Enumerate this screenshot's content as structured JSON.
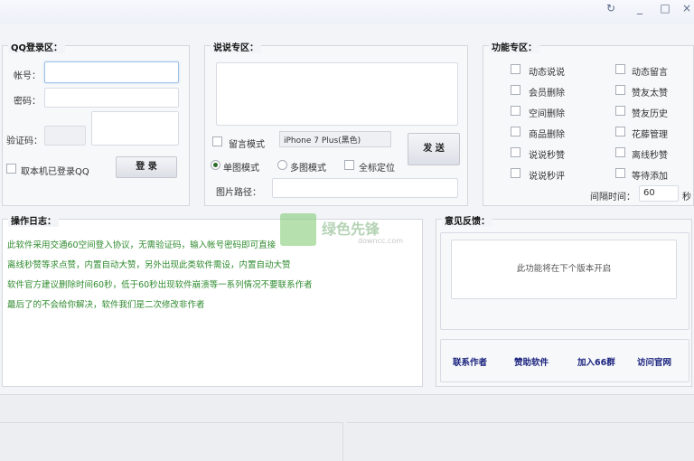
{
  "window": {
    "controls": [
      "↻",
      "_",
      "□",
      "×"
    ]
  },
  "qq_login": {
    "title": "QQ登录区：",
    "account_label": "帐号：",
    "account_value": "",
    "password_label": "密码：",
    "password_value": "",
    "captcha_label": "验证码：",
    "captcha_value": "",
    "use_logged_in_label": "取本机已登录QQ",
    "login_button": "登 录"
  },
  "comment": {
    "title": "说说专区：",
    "content": "",
    "tail_mode_label": "留言模式",
    "device_select": "iPhone 7 Plus(黑色)",
    "send_button": "发 送",
    "single_mode_label": "单图模式",
    "multi_mode_label": "多图模式",
    "fullscreen_label": "全标定位",
    "image_path_label": "图片路径：",
    "image_path_value": ""
  },
  "features": {
    "title": "功能专区：",
    "left": [
      "动态说说",
      "会员删除",
      "空间删除",
      "商品删除",
      "说说秒赞",
      "说说秒评"
    ],
    "right": [
      "动态留言",
      "赞友太赞",
      "赞友历史",
      "花藤管理",
      "离线秒赞",
      "等待添加"
    ],
    "interval_label": "间隔时间：",
    "interval_value": "60",
    "interval_unit": "秒"
  },
  "log": {
    "title": "操作日志：",
    "lines": [
      "此软件采用交通60空间登入协议，无需验证码，输入帐号密码即可直接",
      "离线秒赞等求点赞，内置自动大赞，另外出现此类软件需设，内置自动大赞",
      "软件官方建议删除时间60秒，低于60秒出现软件崩溃等一系列情况不要联系作者",
      "最后了的不会给你解决，软件我们是二次修改非作者"
    ]
  },
  "feedback": {
    "title": "意见反馈：",
    "notice": "此功能将在下个版本开启",
    "links": [
      "联系作者",
      "赞助软件",
      "加入66群",
      "访问官网"
    ]
  },
  "watermark": {
    "text": "绿色先锋",
    "sub": "downcc.com"
  }
}
